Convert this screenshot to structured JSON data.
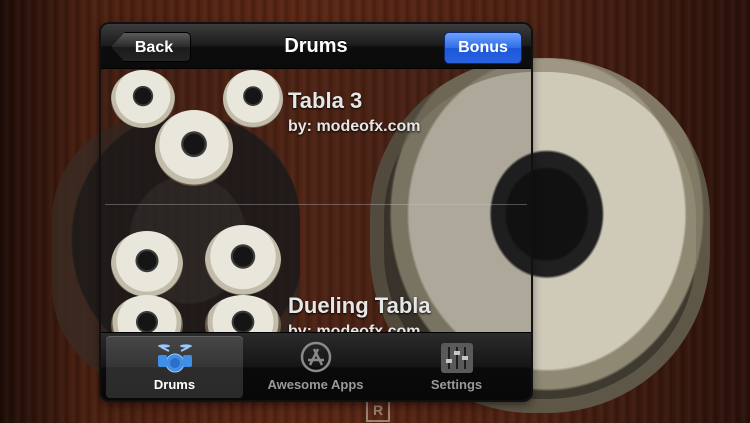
{
  "navbar": {
    "title": "Drums",
    "back_label": "Back",
    "bonus_label": "Bonus"
  },
  "list": {
    "items": [
      {
        "title": "Tabla 3",
        "author": "by: modeofx.com"
      },
      {
        "title": "Dueling Tabla",
        "author": "by: modeofx.com"
      }
    ]
  },
  "tabbar": {
    "tabs": [
      {
        "label": "Drums",
        "icon": "drum-kit-icon",
        "selected": true
      },
      {
        "label": "Awesome Apps",
        "icon": "app-store-icon",
        "selected": false
      },
      {
        "label": "Settings",
        "icon": "sliders-icon",
        "selected": false
      }
    ]
  },
  "background": {
    "badge_text": "R"
  },
  "colors": {
    "accent": "#2f6de6",
    "active_icon": "#3f8fe8"
  }
}
